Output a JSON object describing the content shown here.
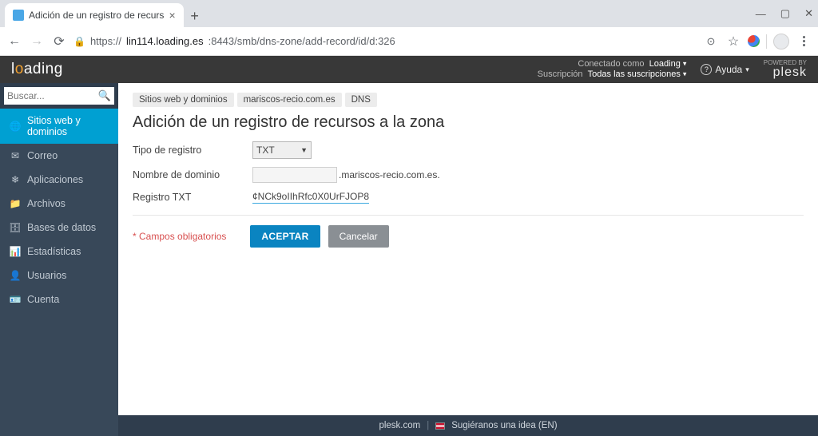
{
  "browser": {
    "tab_title": "Adición de un registro de recurs",
    "url_host": "lin114.loading.es",
    "url_path": ":8443/smb/dns-zone/add-record/id/d:326"
  },
  "header": {
    "brand_pre": "l",
    "brand_accent": "o",
    "brand_post": "ading",
    "connected_as_label": "Conectado como",
    "subscription_label": "Suscripción",
    "user_name": "Loading",
    "subscription_value": "Todas las suscripciones",
    "help_label": "Ayuda",
    "powered_by": "POWERED BY",
    "plesk": "plesk"
  },
  "sidebar": {
    "search_placeholder": "Buscar...",
    "items": [
      {
        "icon": "🌐",
        "label": "Sitios web y dominios",
        "active": true
      },
      {
        "icon": "✉",
        "label": "Correo"
      },
      {
        "icon": "❄",
        "label": "Aplicaciones"
      },
      {
        "icon": "📁",
        "label": "Archivos"
      },
      {
        "icon": "🗄",
        "label": "Bases de datos"
      },
      {
        "icon": "📊",
        "label": "Estadísticas"
      },
      {
        "icon": "👤",
        "label": "Usuarios"
      },
      {
        "icon": "🪪",
        "label": "Cuenta"
      }
    ]
  },
  "breadcrumb": [
    "Sitios web y dominios",
    "mariscos-recio.com.es",
    "DNS"
  ],
  "page_title": "Adición de un registro de recursos a la zona",
  "form": {
    "type_label": "Tipo de registro",
    "type_value": "TXT",
    "domain_label": "Nombre de dominio",
    "domain_suffix": ".mariscos-recio.com.es.",
    "txt_label": "Registro TXT",
    "txt_value": "¢NCk9oIIhRfc0X0UrFJOP8",
    "required_note": "Campos obligatorios",
    "accept": "ACEPTAR",
    "cancel": "Cancelar"
  },
  "footer": {
    "plesk": "plesk.com",
    "suggest": "Sugiéranos una idea (EN)"
  }
}
